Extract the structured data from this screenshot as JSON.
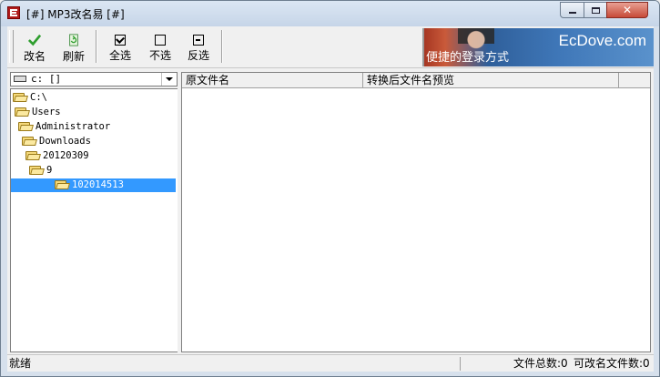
{
  "window": {
    "title": "[#] MP3改名易 [#]",
    "close_glyph": "✕"
  },
  "toolbar": {
    "rename_label": "改名",
    "refresh_label": "刷新",
    "select_all_label": "全选",
    "select_none_label": "不选",
    "invert_label": "反选"
  },
  "banner": {
    "brand": "EcDove.com",
    "slogan": "便捷的登录方式"
  },
  "drive": {
    "selected": "c: []"
  },
  "tree": {
    "items": [
      {
        "label": "C:\\",
        "level": 0
      },
      {
        "label": "Users",
        "level": 1
      },
      {
        "label": "Administrator",
        "level": 2
      },
      {
        "label": "Downloads",
        "level": 3
      },
      {
        "label": "20120309",
        "level": 4
      },
      {
        "label": "9",
        "level": 5
      },
      {
        "label": "102014513",
        "level": 6,
        "selected": true
      }
    ]
  },
  "list": {
    "columns": [
      "原文件名",
      "转换后文件名预览"
    ]
  },
  "status": {
    "ready": "就绪",
    "total_files": "文件总数:0",
    "renamable_files": "可改名文件数:0"
  },
  "colors": {
    "selection": "#3399ff",
    "folder": "#f5d97a",
    "close_button": "#c74a38"
  }
}
